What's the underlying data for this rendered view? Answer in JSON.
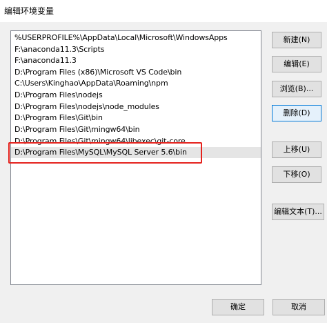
{
  "window": {
    "title": "编辑环境变量"
  },
  "paths": [
    "%USERPROFILE%\\AppData\\Local\\Microsoft\\WindowsApps",
    "F:\\anaconda11.3\\Scripts",
    "F:\\anaconda11.3",
    "D:\\Program Files (x86)\\Microsoft VS Code\\bin",
    "C:\\Users\\Kinghao\\AppData\\Roaming\\npm",
    "D:\\Program Files\\nodejs",
    "D:\\Program Files\\nodejs\\node_modules",
    "D:\\Program Files\\Git\\bin",
    "D:\\Program Files\\Git\\mingw64\\bin",
    "D:\\Program Files\\Git\\mingw64\\libexec\\git-core",
    "D:\\Program Files\\MySQL\\MySQL Server 5.6\\bin"
  ],
  "buttons": {
    "new": "新建(N)",
    "edit": "编辑(E)",
    "browse": "浏览(B)...",
    "delete": "删除(D)",
    "move_up": "上移(U)",
    "move_down": "下移(O)",
    "edit_text": "编辑文本(T)...",
    "ok": "确定",
    "cancel": "取消"
  },
  "colors": {
    "highlight_annotation": "#e5221d",
    "focus_border": "#0078d7"
  }
}
